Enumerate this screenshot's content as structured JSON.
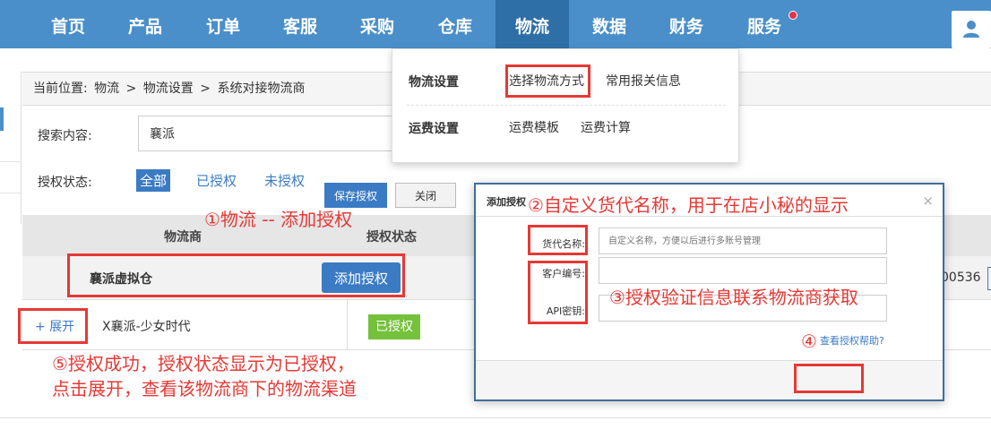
{
  "nav": {
    "items": [
      "首页",
      "产品",
      "订单",
      "客服",
      "采购",
      "仓库",
      "物流",
      "数据",
      "财务",
      "服务"
    ],
    "active": "物流"
  },
  "breadcrumb": {
    "prefix": "当前位置:",
    "parts": [
      "物流",
      ">",
      "物流设置",
      ">",
      "系统对接物流商"
    ]
  },
  "search": {
    "label": "搜索内容:",
    "value": "襄派"
  },
  "filter": {
    "label": "授权状态:",
    "options": [
      "全部",
      "已授权",
      "未授权"
    ],
    "selected": "全部"
  },
  "table": {
    "headers": [
      "物流商",
      "授权状态"
    ],
    "group_row": {
      "name": "襄派虚拟仓",
      "button": "添加授权",
      "partial_text": "00536"
    },
    "sub_row": {
      "expand": "+ 展开",
      "name": "X襄派-少女时代",
      "status": "已授权"
    }
  },
  "dropdown": {
    "sections": [
      {
        "title": "物流设置",
        "links": [
          "选择物流方式",
          "常用报关信息"
        ]
      },
      {
        "title": "运费设置",
        "links": [
          "运费模板",
          "运费计算"
        ]
      }
    ]
  },
  "modal": {
    "title": "添加授权",
    "close": "×",
    "fields": [
      {
        "label": "货代名称:",
        "placeholder": "自定义名称，方便以后进行多账号管理"
      },
      {
        "label": "客户编号:",
        "placeholder": ""
      },
      {
        "label": "API密钥:",
        "placeholder": ""
      }
    ],
    "help": "查看授权帮助?",
    "save": "保存授权",
    "close_btn": "关闭"
  },
  "annotations": {
    "a1": "①物流 -- 添加授权",
    "a2": "②自定义货代名称，用于在店小秘的显示",
    "a3": "③授权验证信息联系物流商获取",
    "a4": "④",
    "a5_line1": "⑤授权成功，授权状态显示为已授权，",
    "a5_line2": "点击展开，查看该物流商下的物流渠道"
  },
  "colors": {
    "nav_bg": "#4a8fc9",
    "nav_active": "#2f6fa8",
    "accent": "#3b7bc4",
    "annotation_red": "#e53935",
    "authorized_green": "#75c13c"
  }
}
